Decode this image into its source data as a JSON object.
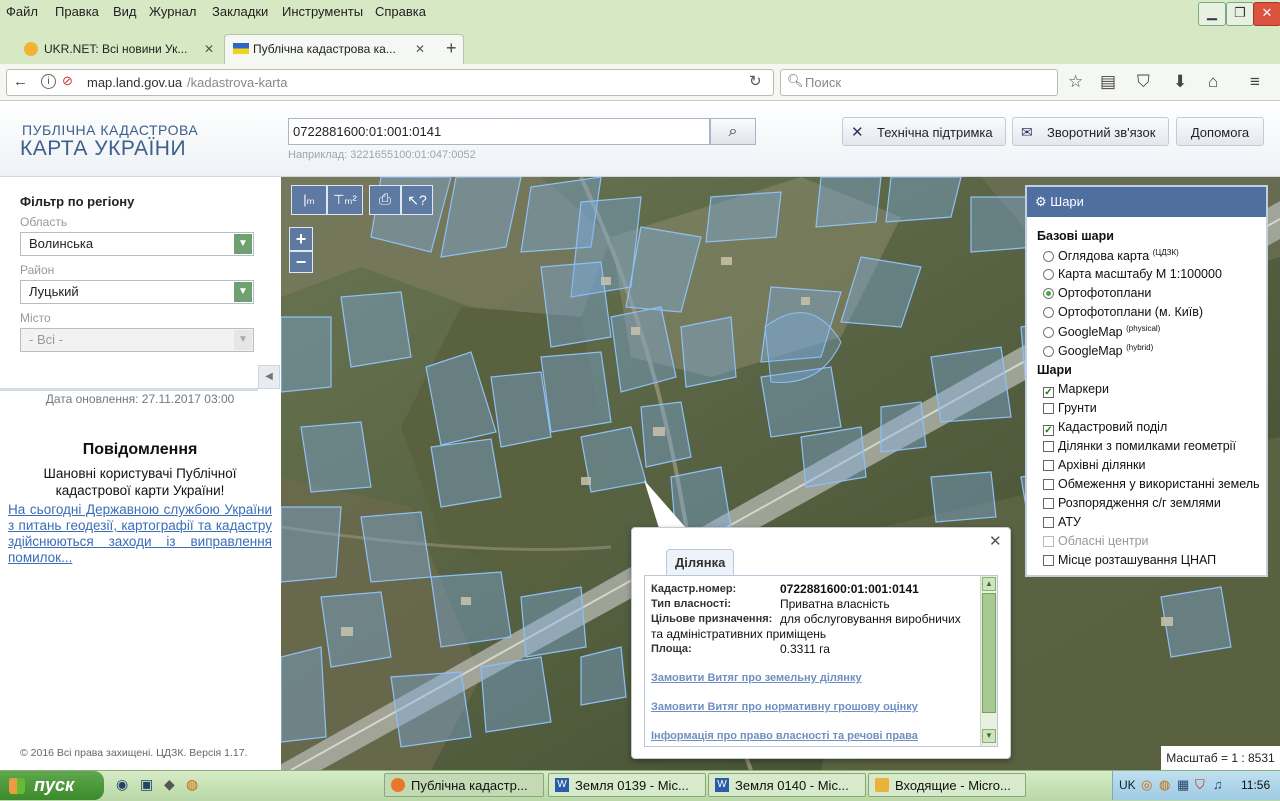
{
  "browser": {
    "menu": [
      "Файл",
      "Правка",
      "Вид",
      "Журнал",
      "Закладки",
      "Инструменты",
      "Справка"
    ],
    "tabs": [
      {
        "label": "UKR.NET: Всі новини Ук...",
        "active": false
      },
      {
        "label": "Публічна кадастрова ка...",
        "active": true
      }
    ],
    "url_host": "map.land.gov.ua",
    "url_path": "/kadastrova-karta",
    "search_placeholder": "Поиск"
  },
  "site": {
    "logo_line1": "ПУБЛІЧНА КАДАСТРОВА",
    "logo_line2": "КАРТА УКРАЇНИ",
    "search_value": "0722881600:01:001:0141",
    "search_example": "Наприклад: 3221655100:01:047:0052",
    "buttons": {
      "support": "Технічна підтримка",
      "feedback": "Зворотний зв'язок",
      "help": "Допомога"
    }
  },
  "filter": {
    "title": "Фільтр по регіону",
    "oblast_label": "Область",
    "oblast_value": "Волинська",
    "raion_label": "Район",
    "raion_value": "Луцький",
    "misto_label": "Місто",
    "misto_value": "- Всі -",
    "updated": "Дата оновлення: 27.11.2017 03:00"
  },
  "notice": {
    "title": "Повідомлення",
    "text": "Шановні користувачі Публічної кадастрової карти України!",
    "link": "На сьогодні Державною службою України з питань геодезії, картографії та кадастру здійснюються заходи із виправлення помилок..."
  },
  "footer": "© 2016 Всі права захищені. ЦДЗК. Версія 1.17.",
  "map": {
    "tools": {
      "zoom_in": "+",
      "zoom_out": "−"
    },
    "scale": "Масштаб = 1 : 8531"
  },
  "layers": {
    "title": "Шари",
    "base_title": "Базові шари",
    "base": [
      {
        "label": "Оглядова карта",
        "sup": "(ЦДЗК)",
        "on": false
      },
      {
        "label": "Карта масштабу М 1:100000",
        "sup": "",
        "on": false
      },
      {
        "label": "Ортофотоплани",
        "sup": "",
        "on": true
      },
      {
        "label": "Ортофотоплани (м. Київ)",
        "sup": "",
        "on": false
      },
      {
        "label": "GoogleMap",
        "sup": "(physical)",
        "on": false
      },
      {
        "label": "GoogleMap",
        "sup": "(hybrid)",
        "on": false
      }
    ],
    "overlay_title": "Шари",
    "overlays": [
      {
        "label": "Маркери",
        "checked": true
      },
      {
        "label": "Грунти",
        "checked": false
      },
      {
        "label": "Кадастровий поділ",
        "checked": true
      },
      {
        "label": "Ділянки з помилками геометрії",
        "checked": false
      },
      {
        "label": "Архівні ділянки",
        "checked": false
      },
      {
        "label": "Обмеження у використанні земель",
        "checked": false
      },
      {
        "label": "Розпорядження с/г землями",
        "checked": false
      },
      {
        "label": "АТУ",
        "checked": false
      },
      {
        "label": "Обласні центри",
        "checked": false,
        "disabled": true
      },
      {
        "label": "Місце розташування ЦНАП",
        "checked": false
      }
    ]
  },
  "popup": {
    "tab": "Ділянка",
    "rows": [
      {
        "label": "Кадастр.номер:",
        "value": "0722881600:01:001:0141",
        "bold": true
      },
      {
        "label": "Тип власності:",
        "value": "Приватна власність"
      },
      {
        "label": "Цільове призначення:",
        "value": "для обслуговування виробничих"
      },
      {
        "label": "",
        "value": "та адміністративних приміщень"
      },
      {
        "label": "Площа:",
        "value": "0.3311 га"
      }
    ],
    "links": [
      "Замовити Витяг про земельну ділянку",
      "Замовити Витяг про нормативну грошову оцінку",
      "Інформація про право власності та речові права"
    ]
  },
  "taskbar": {
    "start": "пуск",
    "tasks": [
      "Публічна кадастр...",
      "Земля 0139 - Mic...",
      "Земля 0140 - Mic...",
      "Входящие - Micro..."
    ],
    "lang": "UK",
    "clock": "11:56"
  },
  "colors": {
    "parcel": "#7fb0ea",
    "accent": "#4f6fa1",
    "menubar": "#d6e8c4"
  }
}
